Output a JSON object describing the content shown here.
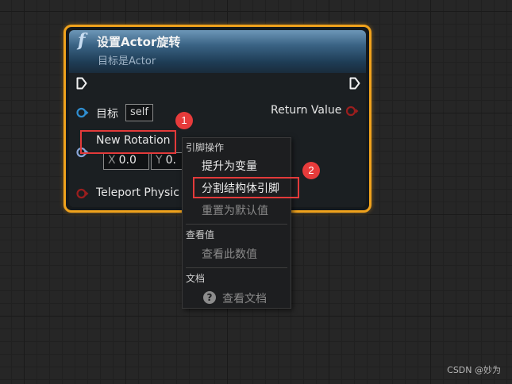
{
  "node": {
    "func_glyph": "f",
    "title": "设置Actor旋转",
    "subtitle": "目标是Actor",
    "pins": {
      "target_label": "目标",
      "self_value": "self",
      "return_label": "Return Value",
      "rotation_label": "New Rotation",
      "x_axis": "X",
      "x_value": "0.0",
      "y_axis": "Y",
      "y_value": "0.",
      "teleport_label": "Teleport Physic"
    }
  },
  "callouts": {
    "badge1": "1",
    "badge2": "2"
  },
  "context_menu": {
    "section_pin": "引脚操作",
    "promote": "提升为变量",
    "split": "分割结构体引脚",
    "reset": "重置为默认值",
    "section_watch": "查看值",
    "watch": "查看此数值",
    "section_docs": "文档",
    "docs": "查看文档"
  },
  "watermark": "CSDN @妙为",
  "colors": {
    "node_border": "#f0a21c",
    "callout_red": "#e33a3a",
    "object_pin": "#2f8ed1",
    "struct_pin": "#8aa6d8",
    "bool_pin": "#9b1e1e"
  },
  "icons": {
    "function": "function-icon",
    "exec": "exec-pin-icon",
    "help": "help-icon"
  }
}
